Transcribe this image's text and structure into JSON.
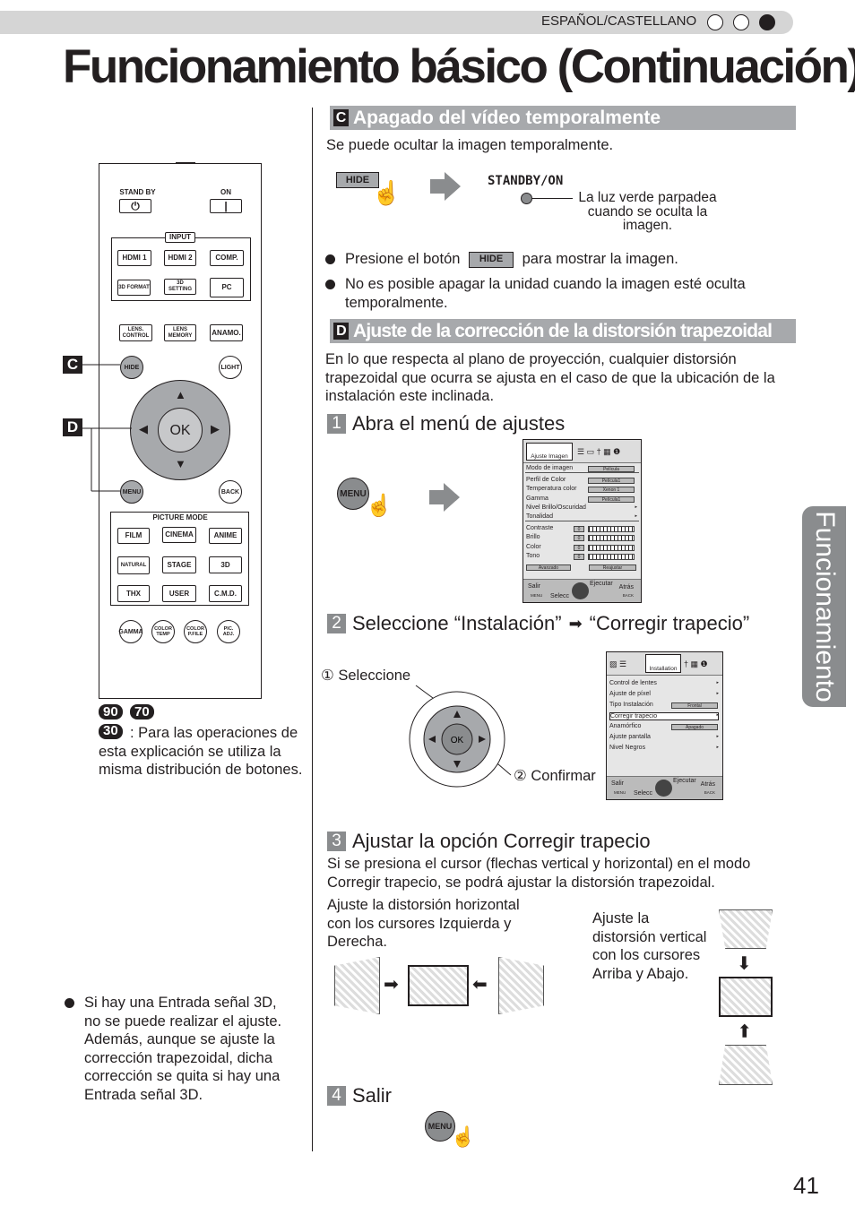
{
  "header": {
    "language": "ESPAÑOL/CASTELLANO",
    "title": "Funcionamiento básico (Continuación)",
    "side_tab": "Funcionamiento",
    "page_number": "41"
  },
  "section_c": {
    "letter": "C",
    "title": "Apagado del vídeo temporalmente",
    "intro": "Se puede ocultar la imagen temporalmente.",
    "hide_button": "HIDE",
    "standby_label": "STANDBY/ON",
    "led_note": "La luz verde parpadea cuando se oculta la imagen.",
    "bullet1_pre": "Presione el botón",
    "bullet1_post": "para mostrar la imagen.",
    "bullet2": "No es posible apagar la unidad cuando la imagen esté oculta temporalmente."
  },
  "section_d": {
    "letter": "D",
    "title": "Ajuste de la corrección de la distorsión trapezoidal",
    "intro": "En lo que respecta al plano de proyección, cualquier distorsión trapezoidal que ocurra se ajusta en el caso de que la ubicación de la instalación este inclinada.",
    "step1": {
      "num": "1",
      "title": "Abra el menú de ajustes",
      "menu_button": "MENU"
    },
    "step2": {
      "num": "2",
      "title_a": "Seleccione “Instalación”",
      "title_b": "“Corregir trapecio”",
      "select": "① Seleccione",
      "confirm": "② Confirmar",
      "ok": "OK"
    },
    "step3": {
      "num": "3",
      "title": "Ajustar la opción Corregir trapecio",
      "text": "Si se presiona el cursor (flechas vertical y horizontal) en el modo Corregir trapecio, se podrá ajustar la distorsión trapezoidal.",
      "horizontal": "Ajuste la distorsión horizontal con los cursores Izquierda y Derecha.",
      "vertical": "Ajuste la distorsión vertical con los cursores Arriba y Abajo."
    },
    "step4": {
      "num": "4",
      "title": "Salir",
      "menu_button": "MENU"
    }
  },
  "menu1": {
    "tab": "Ajuste Imagen",
    "rows": [
      {
        "label": "Modo de imagen",
        "value": "Película"
      },
      {
        "label": "Perfil de Color",
        "value": "Película1"
      },
      {
        "label": "Temperatura color",
        "value": "Xenon 1"
      },
      {
        "label": "Gamma",
        "value": "Película1"
      },
      {
        "label": "Nivel Brillo/Oscuridad"
      },
      {
        "label": "Tonalidad"
      },
      {
        "label": "Contraste",
        "value": "0"
      },
      {
        "label": "Brillo",
        "value": "0"
      },
      {
        "label": "Color",
        "value": "0"
      },
      {
        "label": "Tono",
        "value": "0"
      }
    ],
    "btn_a": "Avanzado",
    "btn_b": "Reajustar",
    "footer": {
      "exit": "Salir",
      "exit_key": "MENU",
      "select": "Selecc",
      "execute": "Ejecutar",
      "back": "Atrás",
      "back_key": "BACK"
    }
  },
  "menu2": {
    "tab": "Installation",
    "rows": [
      {
        "label": "Control de lentes"
      },
      {
        "label": "Ajuste de píxel"
      },
      {
        "label": "Tipo Instalación",
        "value": "Frontal"
      },
      {
        "label": "Corregir trapecio"
      },
      {
        "label": "Anamórfico",
        "value": "Apagado"
      },
      {
        "label": "Ajuste pantalla"
      },
      {
        "label": "Nivel Negros"
      }
    ],
    "footer": {
      "exit": "Salir",
      "exit_key": "MENU",
      "select": "Selecc",
      "execute": "Ejecutar",
      "back": "Atrás",
      "back_key": "BACK"
    }
  },
  "remote": {
    "labels": {
      "standby": "STAND BY",
      "on": "ON",
      "input": "INPUT",
      "picture_mode": "PICTURE MODE",
      "ok": "OK"
    },
    "buttons": [
      "HDMI 1",
      "HDMI 2",
      "COMP.",
      "3D FORMAT",
      "3D SETTING",
      "PC",
      "LENS. CONTROL",
      "LENS MEMORY",
      "ANAMO.",
      "FILM",
      "CINEMA",
      "ANIME",
      "NATURAL",
      "STAGE",
      "3D",
      "THX",
      "USER",
      "C.M.D."
    ],
    "circles": [
      "HIDE",
      "LIGHT",
      "MENU",
      "BACK",
      "GAMMA",
      "COLOR TEMP",
      "COLOR P.FILE",
      "PIC. ADJ."
    ],
    "markers": [
      "C",
      "D"
    ]
  },
  "models": {
    "badges": [
      "90",
      "70",
      "30"
    ],
    "note": ": Para las operaciones de esta explicación se utiliza la misma distribución de botones."
  },
  "note_3d": "Si hay una Entrada señal 3D, no se puede realizar el ajuste. Además, aunque se ajuste la corrección trapezoidal, dicha corrección se quita si hay una Entrada señal 3D."
}
